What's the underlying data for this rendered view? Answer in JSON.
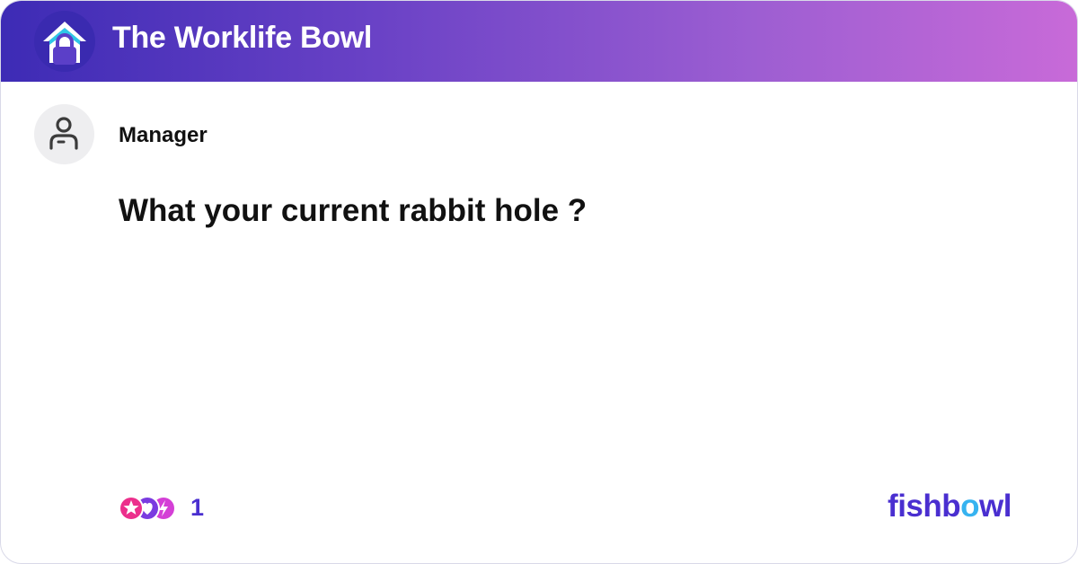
{
  "header": {
    "title": "The Worklife Bowl",
    "logo_icon": "house-lock-icon",
    "gradient": [
      "#3d2bb5",
      "#c86ad8"
    ]
  },
  "post": {
    "avatar_icon": "user-icon",
    "author": "Manager",
    "question": "What your current rabbit hole ?"
  },
  "footer": {
    "reaction_icons": [
      "star-reaction-icon",
      "heart-reaction-icon",
      "bolt-reaction-icon"
    ],
    "reaction_count": "1",
    "brand_prefix": "fishb",
    "brand_accent": "o",
    "brand_suffix": "wl",
    "brand_color": "#4a2fd0",
    "brand_accent_color": "#36b3f0"
  }
}
